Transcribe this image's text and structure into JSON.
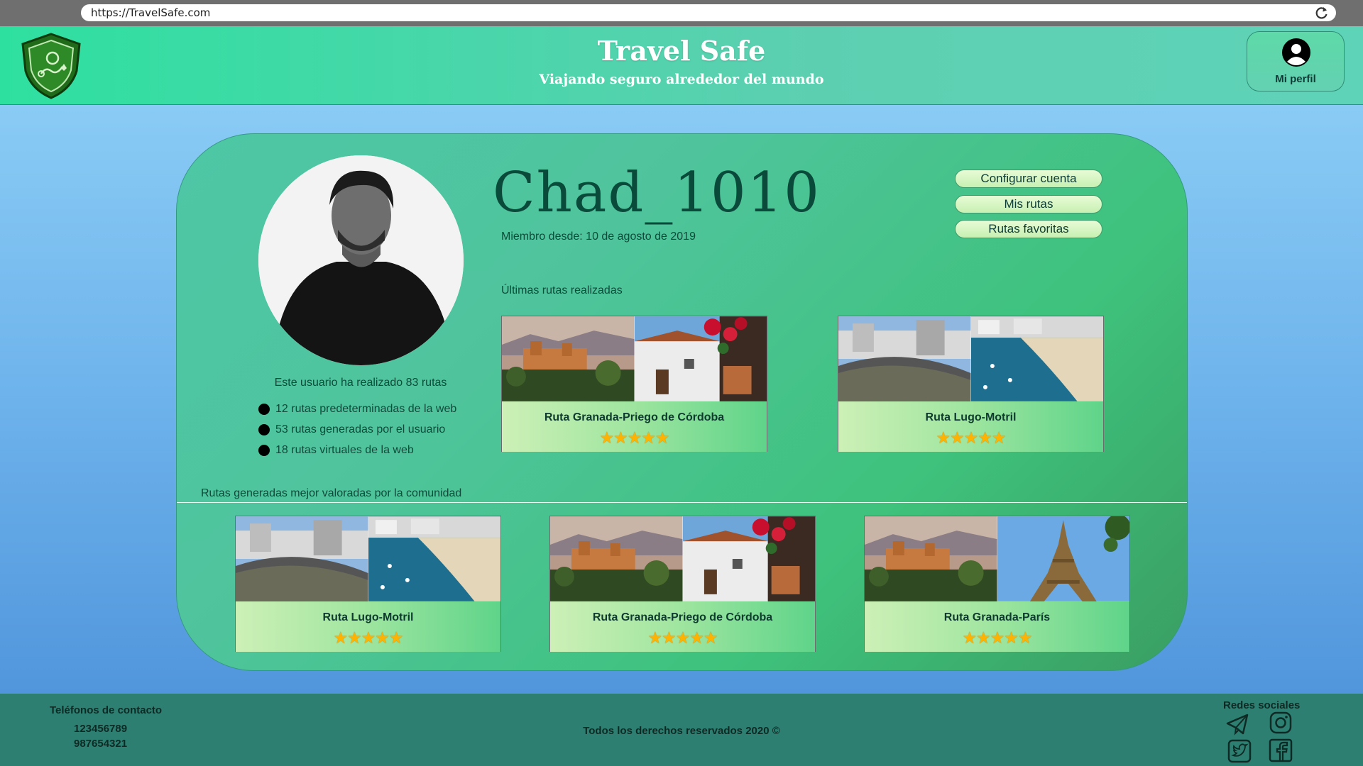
{
  "browser": {
    "url": "https://TravelSafe.com"
  },
  "header": {
    "title": "Travel Safe",
    "subtitle": "Viajando seguro alrededor del mundo",
    "profile_label": "Mi perfil"
  },
  "profile": {
    "username": "Chad_1010",
    "member_since": "Miembro desde: 10 de agosto de 2019",
    "route_summary": "Este usuario ha realizado 83 rutas",
    "stats": [
      "12 rutas predeterminadas de la web",
      "53 rutas generadas por el usuario",
      "18 rutas virtuales de la web"
    ],
    "actions": [
      "Configurar cuenta",
      "Mis rutas",
      "Rutas favoritas"
    ]
  },
  "recent": {
    "heading": "Últimas rutas realizadas",
    "routes": [
      {
        "name": "Ruta Granada-Priego de Córdoba",
        "rating": 5,
        "stars": "★★★★★"
      },
      {
        "name": "Ruta Lugo-Motril",
        "rating": 5,
        "stars": "★★★★★"
      }
    ]
  },
  "community": {
    "heading": "Rutas generadas mejor valoradas por la comunidad",
    "routes": [
      {
        "name": "Ruta Lugo-Motril",
        "rating": 5,
        "stars": "★★★★★"
      },
      {
        "name": "Ruta Granada-Priego de Córdoba",
        "rating": 5,
        "stars": "★★★★★"
      },
      {
        "name": "Ruta Granada-París",
        "rating": 5,
        "stars": "★★★★★"
      }
    ]
  },
  "footer": {
    "contact_heading": "Teléfonos de contacto",
    "phones": [
      "123456789",
      "987654321"
    ],
    "copyright": "Todos los derechos reservados 2020 ©",
    "social_heading": "Redes sociales",
    "social_icons": [
      "telegram-icon",
      "instagram-icon",
      "twitter-icon",
      "facebook-icon"
    ]
  },
  "colors": {
    "header_gradient_start": "#2ee0a0",
    "card_green": "#3ec27c",
    "footer": "#2c7f71",
    "star": "#ffb300"
  }
}
